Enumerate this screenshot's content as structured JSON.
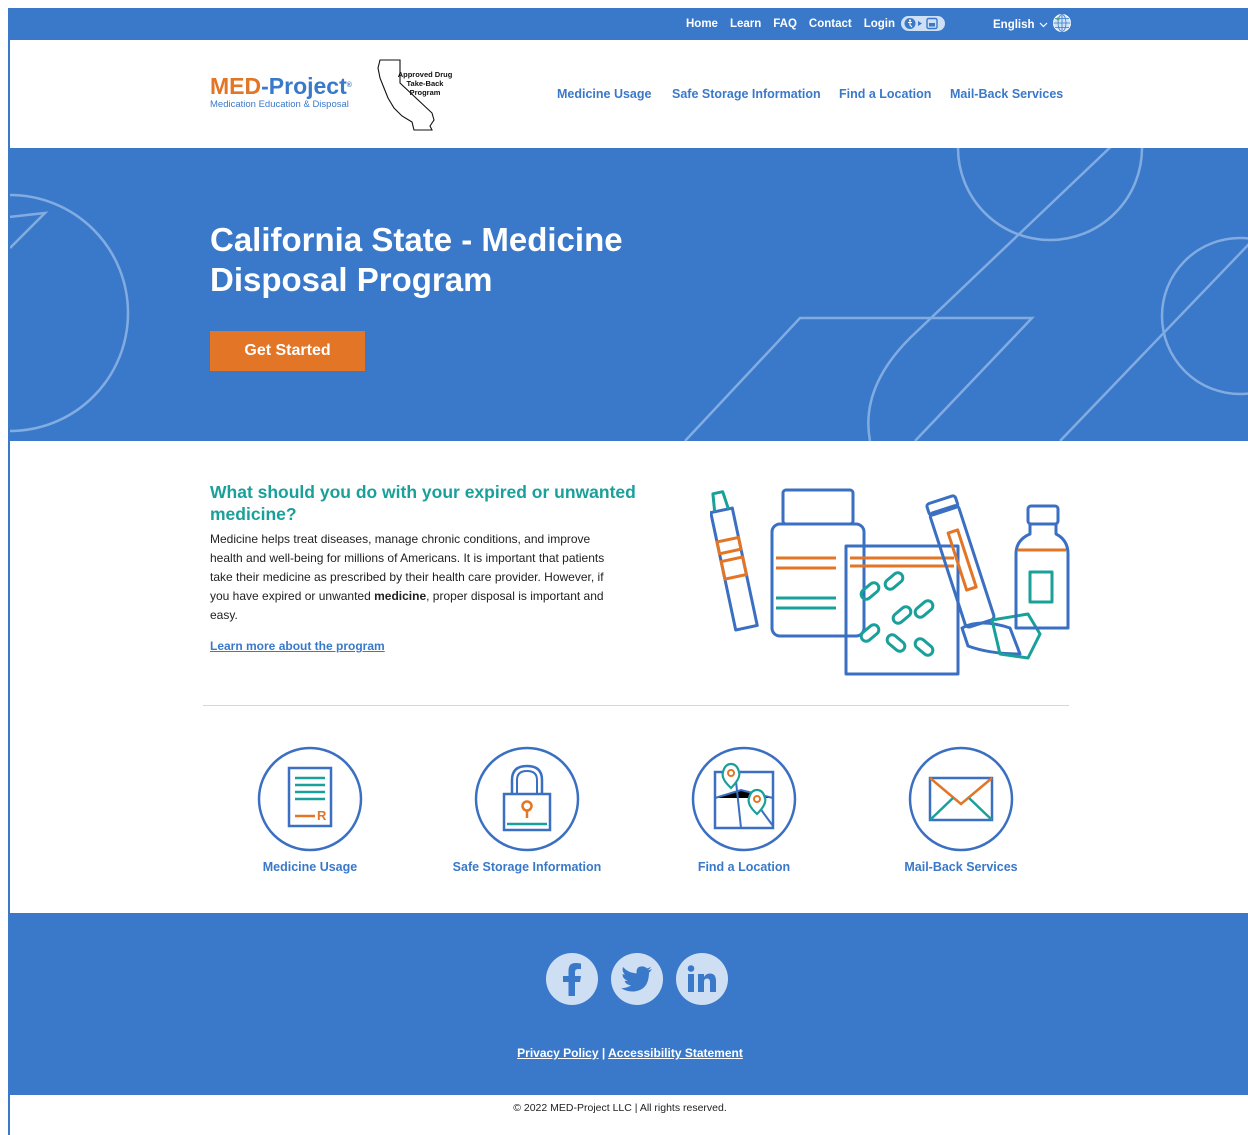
{
  "topbar": {
    "links": [
      "Home",
      "Learn",
      "FAQ",
      "Contact",
      "Login"
    ],
    "language": "English"
  },
  "logo": {
    "brand_orange": "MED",
    "brand_blue": "-Project",
    "tagline": "Medication Education & Disposal",
    "badge_text": "Approved Drug Take-Back Program"
  },
  "nav": {
    "items": [
      "Medicine Usage",
      "Safe Storage Information",
      "Find a Location",
      "Mail-Back Services"
    ]
  },
  "hero": {
    "title": "California State - Medicine Disposal Program",
    "cta": "Get Started"
  },
  "intro": {
    "heading": "What should you do with your expired or unwanted medicine?",
    "body_start": "Medicine helps treat diseases, manage chronic conditions, and improve health and well-being for millions of Americans. It is important that patients take their medicine as prescribed by their health care provider. However, if you have expired or unwanted ",
    "body_bold": "medicine",
    "body_end": ", proper disposal is important and easy.",
    "link": "Learn more about the program"
  },
  "features": [
    {
      "label": "Medicine Usage",
      "icon": "prescription-icon"
    },
    {
      "label": "Safe Storage Information",
      "icon": "lock-icon"
    },
    {
      "label": "Find a Location",
      "icon": "map-pin-icon"
    },
    {
      "label": "Mail-Back Services",
      "icon": "envelope-icon"
    }
  ],
  "footer": {
    "social": [
      "facebook-icon",
      "twitter-icon",
      "linkedin-icon"
    ],
    "privacy": "Privacy Policy",
    "separator": "|",
    "accessibility": "Accessibility Statement",
    "copyright": "© 2022 MED-Project LLC | All rights reserved."
  },
  "colors": {
    "brand_blue": "#3a79c9",
    "brand_orange": "#e27526",
    "teal": "#1aa09a"
  }
}
